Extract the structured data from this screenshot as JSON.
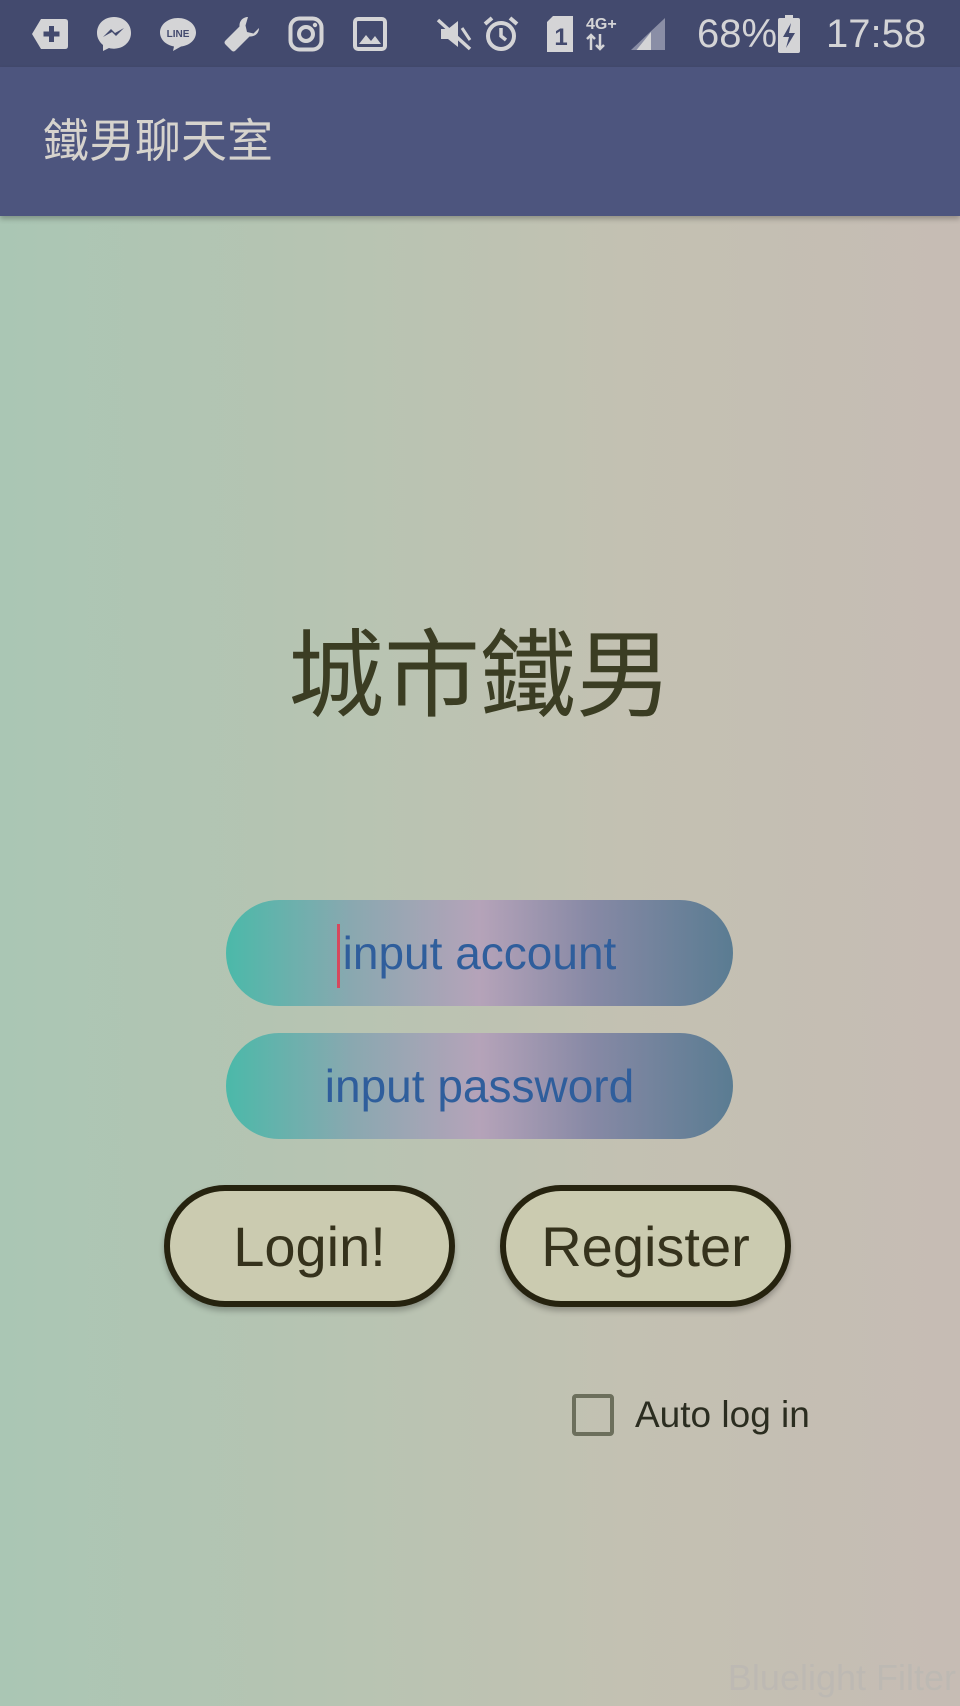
{
  "status_bar": {
    "battery_percent": "68%",
    "time": "17:58",
    "sim_slot": "1",
    "network": "4G+",
    "icons": [
      "add-icon",
      "messenger-icon",
      "line-icon",
      "wrench-icon",
      "instagram-icon",
      "gallery-icon",
      "vibrate-icon",
      "alarm-icon",
      "sim-icon",
      "network-icon",
      "signal-icon",
      "battery-charging-icon"
    ]
  },
  "app_bar": {
    "title": "鐵男聊天室"
  },
  "login": {
    "heading": "城市鐵男",
    "account_placeholder": "input account",
    "password_placeholder": "input password",
    "login_label": "Login!",
    "register_label": "Register",
    "auto_login_label": "Auto log in",
    "auto_login_checked": false
  },
  "watermark": "Bluelight Filter",
  "colors": {
    "status_bar": "#434a6e",
    "app_bar": "#4d557e",
    "input_text": "#2f5e9c",
    "caret": "#d6495e",
    "button_fill": "#cbcbb0",
    "button_border": "#26230f",
    "heading": "#3b3d23"
  }
}
